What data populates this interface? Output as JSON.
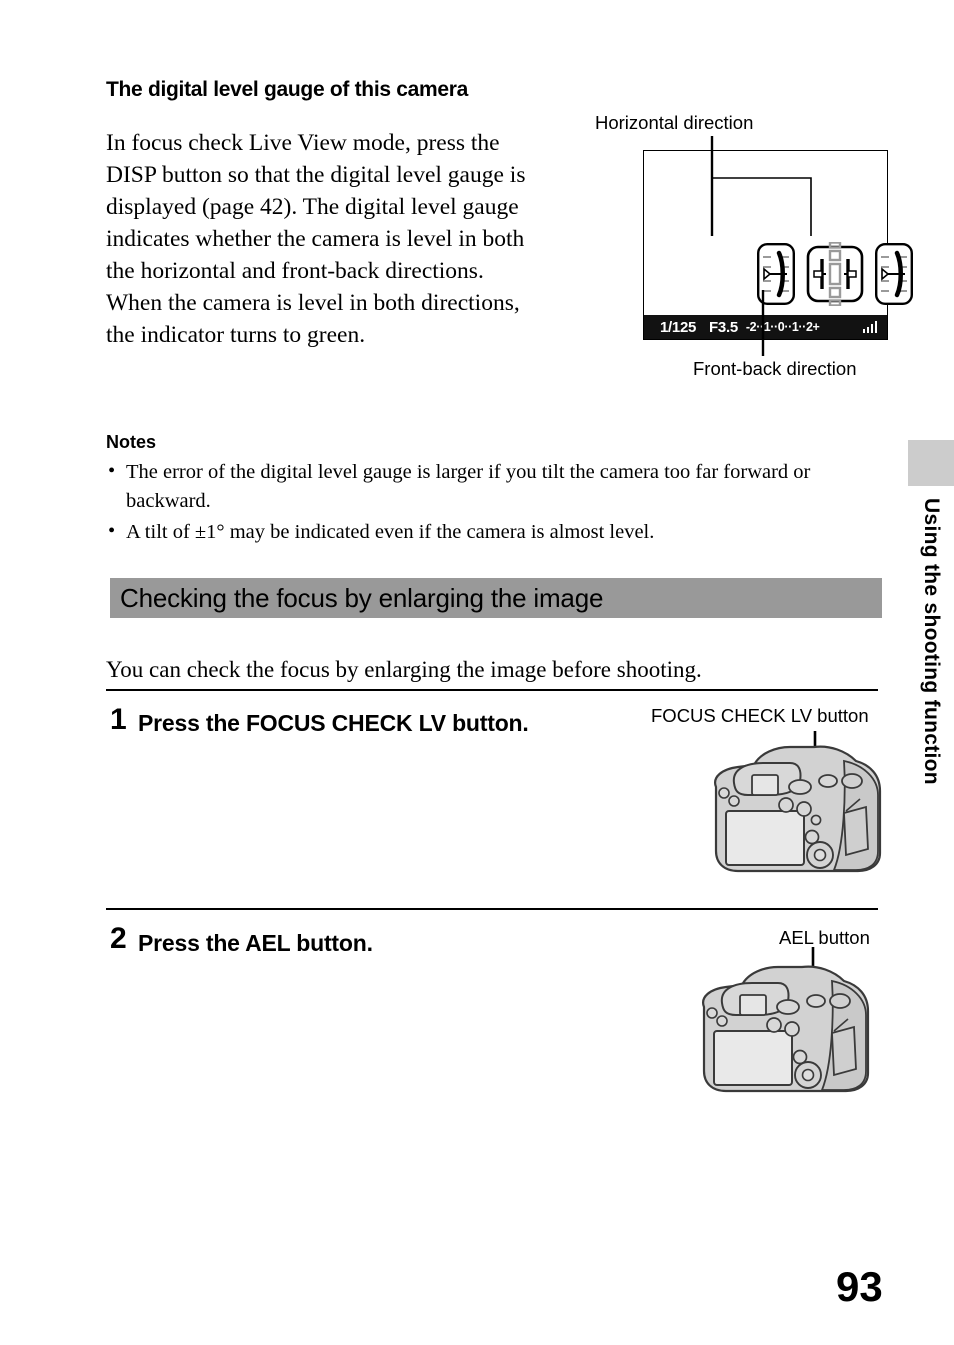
{
  "page": {
    "number": "93",
    "side_tab": "Using the shooting function",
    "side_tab_swatch_color": "#cccccc",
    "section_bar_color": "#999999"
  },
  "top_section": {
    "heading": "The digital level gauge of this camera",
    "paragraph": "In focus check Live View mode, press the DISP button so that the digital level gauge is displayed (page 42). The digital level gauge indicates whether the camera is level in both the horizontal and front-back directions. When the camera is level in both directions, the indicator turns to green."
  },
  "lcd_diagram": {
    "label_top": "Horizontal direction",
    "label_bottom": "Front-back direction",
    "status_bar": {
      "shutter_speed": "1/125",
      "aperture": "F3.5",
      "exposure_scale": "-2··1··0··1··2+",
      "battery_icon": "battery-level-icon"
    },
    "gauges": [
      {
        "name": "horizontal-gauge-left"
      },
      {
        "name": "front-back-gauge-center"
      },
      {
        "name": "horizontal-gauge-right"
      }
    ]
  },
  "notes": {
    "title": "Notes",
    "bullet": "•",
    "items": [
      "The error of the digital level gauge is larger if you tilt the camera too far forward or backward.",
      "A tilt of ±1° may be indicated even if the camera is almost level."
    ]
  },
  "section": {
    "bar_title": "Checking the focus by enlarging the image",
    "lead": "You can check the focus by enlarging the image before shooting."
  },
  "steps": [
    {
      "number": "1",
      "text": "Press the FOCUS CHECK LV button.",
      "callout": "FOCUS CHECK LV button"
    },
    {
      "number": "2",
      "text": "Press the AEL button.",
      "callout": "AEL button"
    }
  ]
}
